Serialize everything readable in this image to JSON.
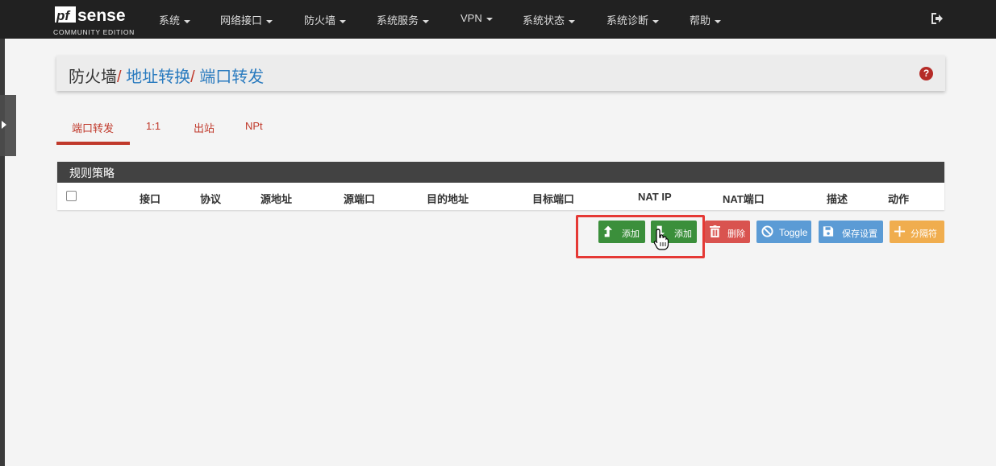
{
  "brand": {
    "name": "pfsense",
    "edition": "COMMUNITY EDITION"
  },
  "nav": {
    "items": [
      "系统",
      "网络接口",
      "防火墙",
      "系统服务",
      "VPN",
      "系统状态",
      "系统诊断",
      "帮助"
    ]
  },
  "breadcrumb": {
    "part0": "防火墙",
    "separator": "/",
    "part1": "地址转换",
    "part2": "端口转发"
  },
  "tabs": [
    "端口转发",
    "1:1",
    "出站",
    "NPt"
  ],
  "active_tab": "端口转发",
  "panel": {
    "title": "规则策略",
    "columns": [
      "接口",
      "协议",
      "源地址",
      "源端口",
      "目的地址",
      "目标端口",
      "NAT IP",
      "NAT端口",
      "描述",
      "动作"
    ]
  },
  "actions": {
    "add_top": "添加",
    "add_bottom": "添加",
    "delete": "删除",
    "toggle": "Toggle",
    "save": "保存设置",
    "separator": "分隔符"
  },
  "colors": {
    "navbar": "#212121",
    "accent_red": "#c0392b",
    "link_blue": "#2a7bbf",
    "green": "#3b8f3b",
    "red": "#d9534f",
    "blue": "#5b9bd5",
    "orange": "#f0ad4e",
    "highlight": "#e53935"
  },
  "icons": {
    "logout": "sign-out-icon",
    "help": "question-circle-icon",
    "add_top": "level-up-icon",
    "add_bottom": "level-down-icon",
    "delete": "trash-icon",
    "toggle": "ban-icon",
    "save": "save-icon",
    "separator": "plus-icon"
  }
}
